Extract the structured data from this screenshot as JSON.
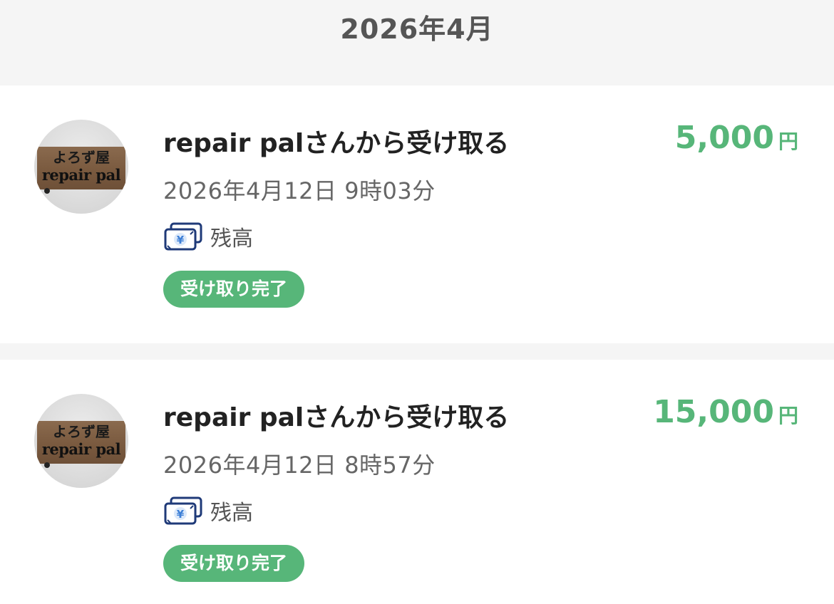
{
  "month_header": {
    "title": "2026年4月"
  },
  "colors": {
    "accent_green": "#57b679",
    "icon_blue": "#1f3a78"
  },
  "transactions": [
    {
      "title": "repair palさんから受け取る",
      "amount": "5,000",
      "currency": "円",
      "datetime": "2026年4月12日 9時03分",
      "method_icon": "yen-bill-icon",
      "method_label": "残高",
      "status": "受け取り完了",
      "avatar": {
        "sign_top": "よろず屋",
        "sign_bottom": "repair pal"
      }
    },
    {
      "title": "repair palさんから受け取る",
      "amount": "15,000",
      "currency": "円",
      "datetime": "2026年4月12日 8時57分",
      "method_icon": "yen-bill-icon",
      "method_label": "残高",
      "status": "受け取り完了",
      "avatar": {
        "sign_top": "よろず屋",
        "sign_bottom": "repair pal"
      }
    }
  ]
}
